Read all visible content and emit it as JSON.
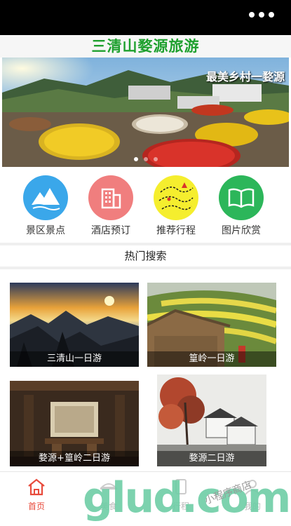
{
  "header": {
    "more_icon": "more-dots-icon"
  },
  "app": {
    "title": "三清山婺源旅游"
  },
  "banner": {
    "caption": "最美乡村一婺源",
    "dots": 3,
    "active_dot": 0
  },
  "menu": {
    "items": [
      {
        "label": "景区景点",
        "icon": "mountain-icon",
        "color": "#3aa7ea"
      },
      {
        "label": "酒店预订",
        "icon": "building-icon",
        "color": "#f07e7e"
      },
      {
        "label": "推荐行程",
        "icon": "route-icon",
        "color": "#f5ee2e"
      },
      {
        "label": "图片欣赏",
        "icon": "book-icon",
        "color": "#2cb65a"
      }
    ]
  },
  "hot": {
    "title": "热门搜索",
    "cards": [
      {
        "label": "三清山一日游"
      },
      {
        "label": "篁岭一日游"
      },
      {
        "label": "婺源+篁岭二日游"
      },
      {
        "label": "婺源二日游"
      }
    ]
  },
  "tabbar": {
    "items": [
      {
        "label": "首页",
        "icon": "home-icon",
        "active": true
      },
      {
        "label": "美食",
        "icon": "food-icon",
        "active": false
      },
      {
        "label": "行程",
        "icon": "trip-icon",
        "active": false
      },
      {
        "label": "我的",
        "icon": "user-icon",
        "active": false
      }
    ]
  },
  "watermark": {
    "text": "glud.com",
    "sub": "小程序商店"
  },
  "colors": {
    "accent": "#1ea02e",
    "tab_active": "#e84b3c"
  }
}
